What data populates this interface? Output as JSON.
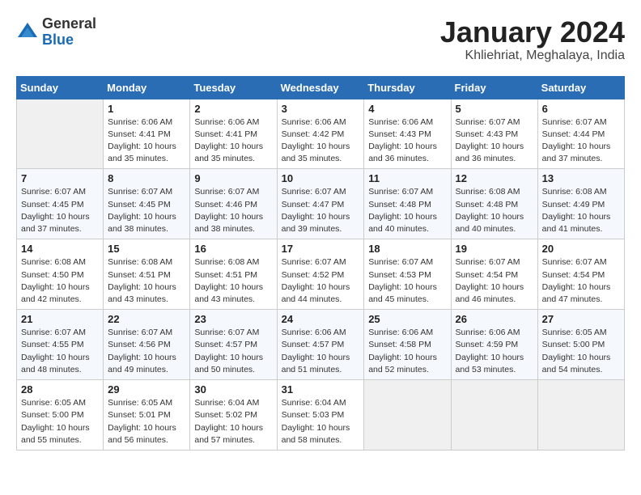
{
  "header": {
    "logo_general": "General",
    "logo_blue": "Blue",
    "month_year": "January 2024",
    "location": "Khliehriat, Meghalaya, India"
  },
  "weekdays": [
    "Sunday",
    "Monday",
    "Tuesday",
    "Wednesday",
    "Thursday",
    "Friday",
    "Saturday"
  ],
  "weeks": [
    [
      {
        "day": "",
        "info": ""
      },
      {
        "day": "1",
        "info": "Sunrise: 6:06 AM\nSunset: 4:41 PM\nDaylight: 10 hours\nand 35 minutes."
      },
      {
        "day": "2",
        "info": "Sunrise: 6:06 AM\nSunset: 4:41 PM\nDaylight: 10 hours\nand 35 minutes."
      },
      {
        "day": "3",
        "info": "Sunrise: 6:06 AM\nSunset: 4:42 PM\nDaylight: 10 hours\nand 35 minutes."
      },
      {
        "day": "4",
        "info": "Sunrise: 6:06 AM\nSunset: 4:43 PM\nDaylight: 10 hours\nand 36 minutes."
      },
      {
        "day": "5",
        "info": "Sunrise: 6:07 AM\nSunset: 4:43 PM\nDaylight: 10 hours\nand 36 minutes."
      },
      {
        "day": "6",
        "info": "Sunrise: 6:07 AM\nSunset: 4:44 PM\nDaylight: 10 hours\nand 37 minutes."
      }
    ],
    [
      {
        "day": "7",
        "info": ""
      },
      {
        "day": "8",
        "info": "Sunrise: 6:07 AM\nSunset: 4:45 PM\nDaylight: 10 hours\nand 38 minutes."
      },
      {
        "day": "9",
        "info": "Sunrise: 6:07 AM\nSunset: 4:46 PM\nDaylight: 10 hours\nand 38 minutes."
      },
      {
        "day": "10",
        "info": "Sunrise: 6:07 AM\nSunset: 4:47 PM\nDaylight: 10 hours\nand 39 minutes."
      },
      {
        "day": "11",
        "info": "Sunrise: 6:07 AM\nSunset: 4:48 PM\nDaylight: 10 hours\nand 40 minutes."
      },
      {
        "day": "12",
        "info": "Sunrise: 6:08 AM\nSunset: 4:48 PM\nDaylight: 10 hours\nand 40 minutes."
      },
      {
        "day": "13",
        "info": "Sunrise: 6:08 AM\nSunset: 4:49 PM\nDaylight: 10 hours\nand 41 minutes."
      }
    ],
    [
      {
        "day": "14",
        "info": ""
      },
      {
        "day": "15",
        "info": "Sunrise: 6:08 AM\nSunset: 4:51 PM\nDaylight: 10 hours\nand 43 minutes."
      },
      {
        "day": "16",
        "info": "Sunrise: 6:08 AM\nSunset: 4:51 PM\nDaylight: 10 hours\nand 43 minutes."
      },
      {
        "day": "17",
        "info": "Sunrise: 6:07 AM\nSunset: 4:52 PM\nDaylight: 10 hours\nand 44 minutes."
      },
      {
        "day": "18",
        "info": "Sunrise: 6:07 AM\nSunset: 4:53 PM\nDaylight: 10 hours\nand 45 minutes."
      },
      {
        "day": "19",
        "info": "Sunrise: 6:07 AM\nSunset: 4:54 PM\nDaylight: 10 hours\nand 46 minutes."
      },
      {
        "day": "20",
        "info": "Sunrise: 6:07 AM\nSunset: 4:54 PM\nDaylight: 10 hours\nand 47 minutes."
      }
    ],
    [
      {
        "day": "21",
        "info": ""
      },
      {
        "day": "22",
        "info": "Sunrise: 6:07 AM\nSunset: 4:56 PM\nDaylight: 10 hours\nand 49 minutes."
      },
      {
        "day": "23",
        "info": "Sunrise: 6:07 AM\nSunset: 4:57 PM\nDaylight: 10 hours\nand 50 minutes."
      },
      {
        "day": "24",
        "info": "Sunrise: 6:06 AM\nSunset: 4:57 PM\nDaylight: 10 hours\nand 51 minutes."
      },
      {
        "day": "25",
        "info": "Sunrise: 6:06 AM\nSunset: 4:58 PM\nDaylight: 10 hours\nand 52 minutes."
      },
      {
        "day": "26",
        "info": "Sunrise: 6:06 AM\nSunset: 4:59 PM\nDaylight: 10 hours\nand 53 minutes."
      },
      {
        "day": "27",
        "info": "Sunrise: 6:05 AM\nSunset: 5:00 PM\nDaylight: 10 hours\nand 54 minutes."
      }
    ],
    [
      {
        "day": "28",
        "info": "Sunrise: 6:05 AM\nSunset: 5:00 PM\nDaylight: 10 hours\nand 55 minutes."
      },
      {
        "day": "29",
        "info": "Sunrise: 6:05 AM\nSunset: 5:01 PM\nDaylight: 10 hours\nand 56 minutes."
      },
      {
        "day": "30",
        "info": "Sunrise: 6:04 AM\nSunset: 5:02 PM\nDaylight: 10 hours\nand 57 minutes."
      },
      {
        "day": "31",
        "info": "Sunrise: 6:04 AM\nSunset: 5:03 PM\nDaylight: 10 hours\nand 58 minutes."
      },
      {
        "day": "",
        "info": ""
      },
      {
        "day": "",
        "info": ""
      },
      {
        "day": "",
        "info": ""
      }
    ]
  ],
  "week1_sun_info": "Sunrise: 6:07 AM\nSunset: 4:45 PM\nDaylight: 10 hours\nand 37 minutes.",
  "week3_sun_info": "Sunrise: 6:08 AM\nSunset: 4:50 PM\nDaylight: 10 hours\nand 42 minutes.",
  "week4_sun_info": "Sunrise: 6:07 AM\nSunset: 4:55 PM\nDaylight: 10 hours\nand 48 minutes."
}
